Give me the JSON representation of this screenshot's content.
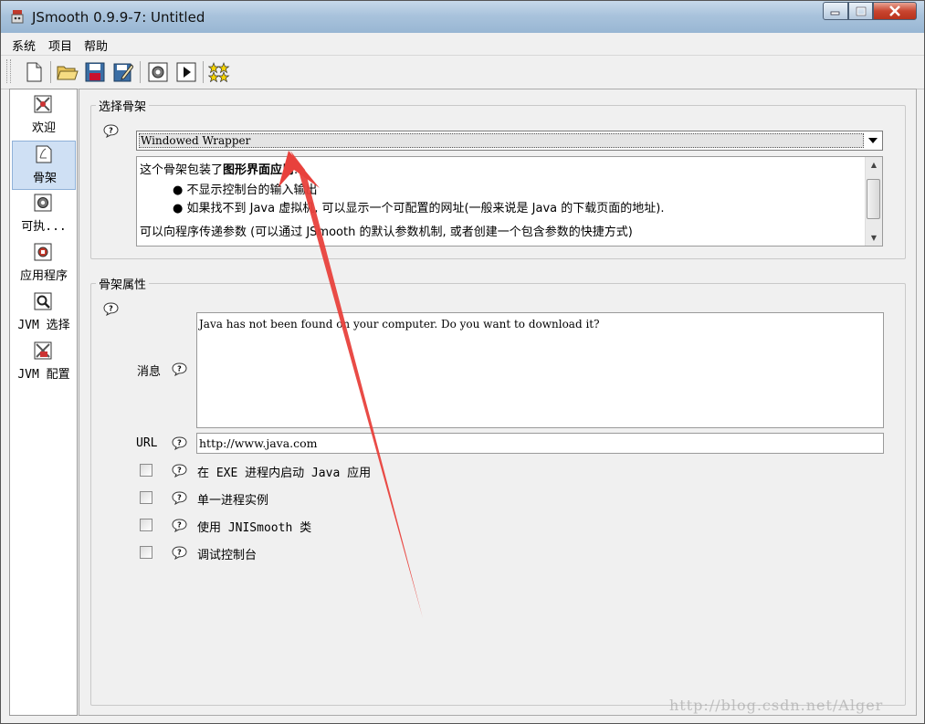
{
  "window": {
    "title": "JSmooth 0.9.9-7: Untitled",
    "controls": {
      "minimize": "—",
      "maximize": "☐",
      "close": "✕"
    }
  },
  "menubar": {
    "items": [
      {
        "label": "系统"
      },
      {
        "label": "项目"
      },
      {
        "label": "帮助"
      }
    ]
  },
  "toolbar": {
    "buttons": [
      "new-file-icon",
      "open-folder-icon",
      "save-disk-icon",
      "save-as-icon",
      "compile-gear-icon",
      "run-play-icon",
      "stars-icon"
    ]
  },
  "sidebar": {
    "items": [
      {
        "label": "欢迎",
        "icon": "welcome-icon",
        "active": false
      },
      {
        "label": "骨架",
        "icon": "skeleton-icon",
        "active": true
      },
      {
        "label": "可执...",
        "icon": "executable-gear-icon",
        "active": false
      },
      {
        "label": "应用程序",
        "icon": "application-icon",
        "active": false
      },
      {
        "label": "JVM 选择",
        "icon": "jvm-select-icon",
        "active": false
      },
      {
        "label": "JVM 配置",
        "icon": "jvm-config-icon",
        "active": false
      }
    ]
  },
  "skeleton_select": {
    "group_title": "选择骨架",
    "selected": "Windowed Wrapper",
    "description": {
      "intro_plain": "这个骨架包装了",
      "intro_bold": "图形界面应用",
      "intro_end": ".",
      "bullets": [
        "不显示控制台的输入输出",
        "如果找不到 Java 虚拟机, 可以显示一个可配置的网址(一般来说是 Java 的下载页面的地址)."
      ],
      "footer": "可以向程序传递参数 (可以通过 JSmooth 的默认参数机制, 或者创建一个包含参数的快捷方式)"
    }
  },
  "skeleton_props": {
    "group_title": "骨架属性",
    "message_label": "消息",
    "message_value": "Java has not been found on your computer. Do you want to download it?",
    "url_label": "URL",
    "url_value": "http://www.java.com",
    "checkboxes": [
      {
        "label": "在 EXE 进程内启动 Java 应用",
        "checked": false
      },
      {
        "label": "单一进程实例",
        "checked": false
      },
      {
        "label": "使用 JNISmooth 类",
        "checked": false
      },
      {
        "label": "调试控制台",
        "checked": false
      }
    ]
  },
  "watermark": "http://blog.csdn.net/Alger",
  "colors": {
    "annotation_arrow": "#e8413c",
    "sidebar_active": "#cfe0f4",
    "title_bar": "#a9c3dc"
  }
}
